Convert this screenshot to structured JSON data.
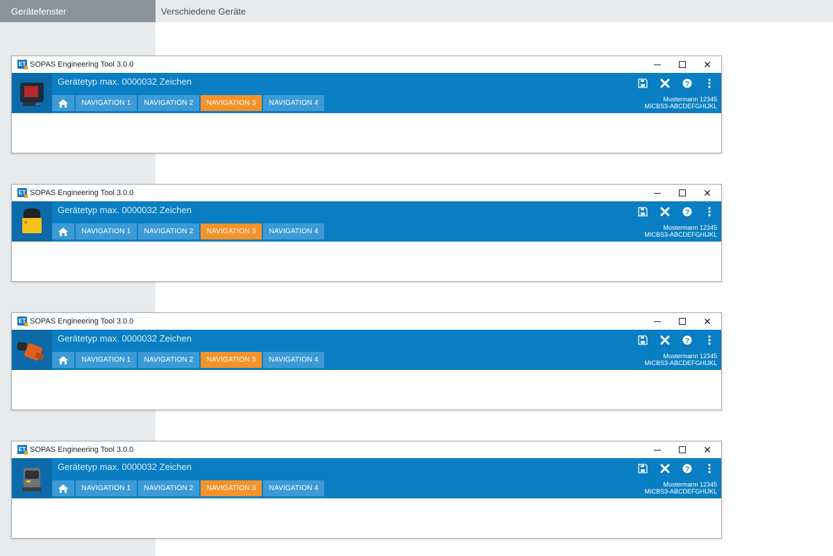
{
  "top_bar": {
    "left_tab_label": "Gerätefenster",
    "title": "Verschiedene Geräte"
  },
  "windows": [
    {
      "title": "SOPAS Engineering Tool 3.0.0",
      "app_icon_text": "ET",
      "device_type": "Gerätetyp max. 0000032 Zeichen",
      "device_icon": "dark-sensor-device-icon",
      "nav": [
        "NAVIGATION 1",
        "NAVIGATION 2",
        "NAVIGATION 3",
        "NAVIGATION 4"
      ],
      "active_nav": "NAVIGATION 3",
      "user": "Mustermann 12345",
      "device_id": "MICBS3-ABCDEFGHIJKL"
    },
    {
      "title": "SOPAS Engineering Tool 3.0.0",
      "app_icon_text": "ET",
      "device_type": "Gerätetyp max. 0000032 Zeichen",
      "device_icon": "yellow-scanner-device-icon",
      "nav": [
        "NAVIGATION 1",
        "NAVIGATION 2",
        "NAVIGATION 3",
        "NAVIGATION 4"
      ],
      "active_nav": "NAVIGATION 3",
      "user": "Mustermann 12345",
      "device_id": "MICBS3-ABCDEFGHIJKL"
    },
    {
      "title": "SOPAS Engineering Tool 3.0.0",
      "app_icon_text": "ET",
      "device_type": "Gerätetyp max. 0000032 Zeichen",
      "device_icon": "orange-encoder-device-icon",
      "nav": [
        "NAVIGATION 1",
        "NAVIGATION 2",
        "NAVIGATION 3",
        "NAVIGATION 4"
      ],
      "active_nav": "NAVIGATION 3",
      "user": "Mustermann 12345",
      "device_id": "MICBS3-ABCDEFGHIJKL"
    },
    {
      "title": "SOPAS Engineering Tool 3.0.0",
      "app_icon_text": "ET",
      "device_type": "Gerätetyp max. 0000032 Zeichen",
      "device_icon": "gray-lidar-device-icon",
      "nav": [
        "NAVIGATION 1",
        "NAVIGATION 2",
        "NAVIGATION 3",
        "NAVIGATION 4"
      ],
      "active_nav": "NAVIGATION 3",
      "user": "Mustermann 12345",
      "device_id": "MICBS3-ABCDEFGHIJKL"
    }
  ],
  "colors": {
    "header_blue": "#0a7ec2",
    "nav_blue": "#3c9bd6",
    "nav_active": "#f5922a",
    "left_panel": "#e7ebee",
    "left_tab": "#8b949c"
  }
}
